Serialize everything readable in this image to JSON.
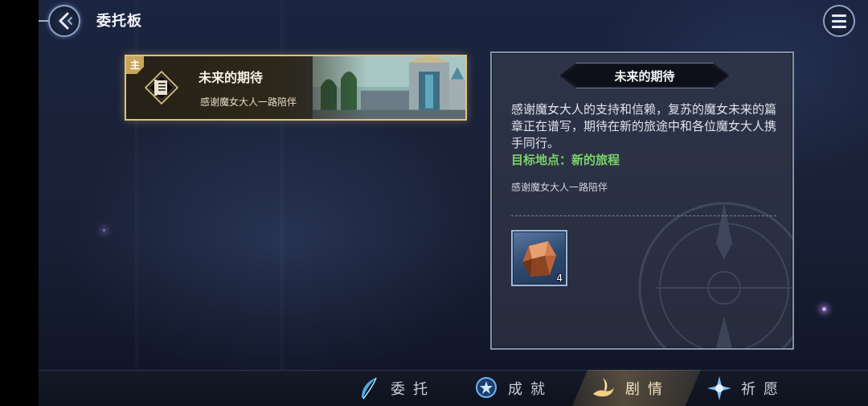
{
  "header": {
    "title": "委托板",
    "back_icon": "back-arrow-icon",
    "menu_icon": "hamburger-menu-icon"
  },
  "quest_list": [
    {
      "tag": "主",
      "title": "未来的期待",
      "subtitle": "感谢魔女大人一路陪伴",
      "icon": "scroll-document-icon",
      "selected": true
    }
  ],
  "detail": {
    "title": "未来的期待",
    "description": "感谢魔女大人的支持和信赖，复苏的魔女未来的篇章正在谱写，期待在新的旅途中和各位魔女大人携手同行。",
    "target_label": "目标地点：",
    "target_value": "新的旅程",
    "note": "感谢魔女大人一路陪伴",
    "reward": {
      "icon": "orange-crystal-icon",
      "count": "4"
    }
  },
  "bottom_nav": [
    {
      "label": "委托",
      "icon": "feather-quill-icon",
      "active": false
    },
    {
      "label": "成就",
      "icon": "medal-badge-icon",
      "active": false
    },
    {
      "label": "剧情",
      "icon": "lamp-icon",
      "active": true
    },
    {
      "label": "祈愿",
      "icon": "star-burst-icon",
      "active": false
    }
  ],
  "colors": {
    "accent_gold": "#e0c27a",
    "target_green": "#7ad36a",
    "panel_border": "#8592a8"
  }
}
